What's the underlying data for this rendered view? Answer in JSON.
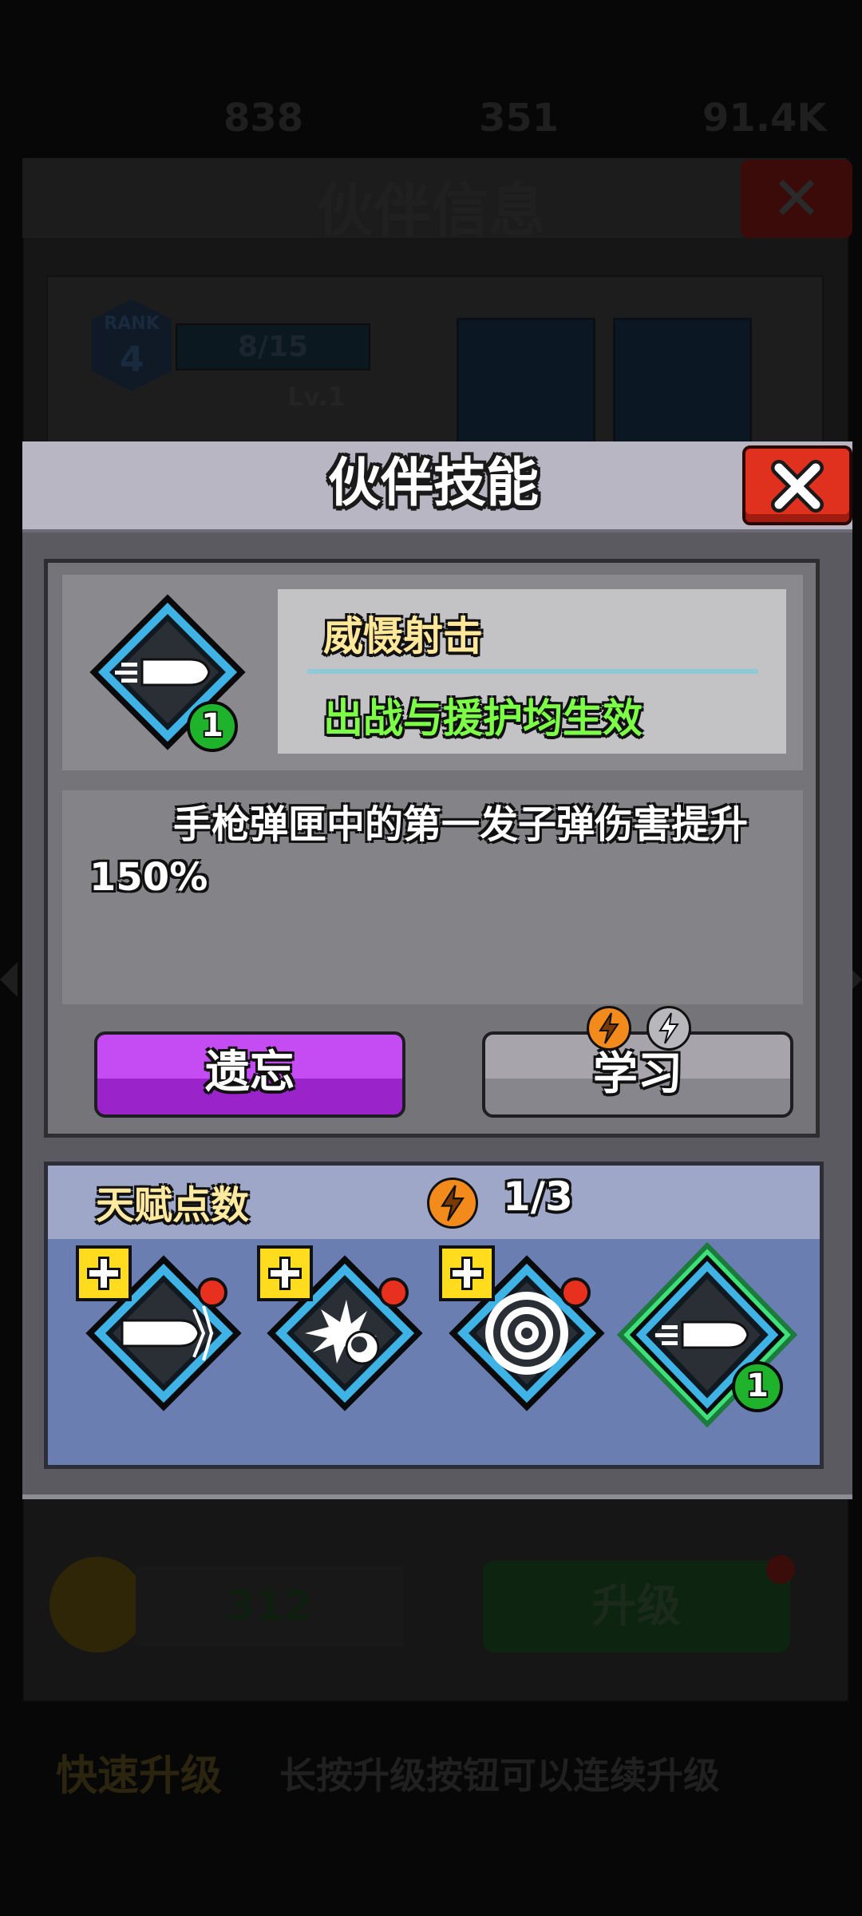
{
  "background": {
    "resources": [
      "838",
      "351",
      "91.4K"
    ],
    "panel_title": "伙伴信息",
    "rank_label": "RANK",
    "rank_value": "4",
    "progress": "8/15",
    "level": "Lv.1",
    "coin_cost": "312",
    "upgrade_label": "升级",
    "tip_title": "快速升级",
    "tip_text": "长按升级按钮可以连续升级"
  },
  "modal": {
    "title": "伙伴技能",
    "skill": {
      "icon": "bullet-icon",
      "level": "1",
      "name": "威慑射击",
      "scope": "出战与援护均生效",
      "description": "手枪弹匣中的第一发子弹伤害提升150%"
    },
    "forget_label": "遗忘",
    "learn_label": "学习",
    "learn_cost_icons": [
      "orange-lightning-icon",
      "gray-lightning-icon"
    ],
    "talent": {
      "label": "天赋点数",
      "icon": "lightning-icon",
      "count": "1/3",
      "slots": [
        {
          "icon": "piercing-bullet-icon",
          "has_plus": true,
          "has_dot": true
        },
        {
          "icon": "explosion-icon",
          "has_plus": true,
          "has_dot": true
        },
        {
          "icon": "target-icon",
          "has_plus": true,
          "has_dot": true
        },
        {
          "icon": "bullet-icon",
          "selected": true,
          "level": "1"
        }
      ]
    },
    "colors": {
      "skill_name": "#ffe89a",
      "skill_scope": "#7cff46",
      "forget_button": "#b53ae6",
      "close_button": "#e0311f",
      "selected_glow": "#3ee07a"
    }
  }
}
